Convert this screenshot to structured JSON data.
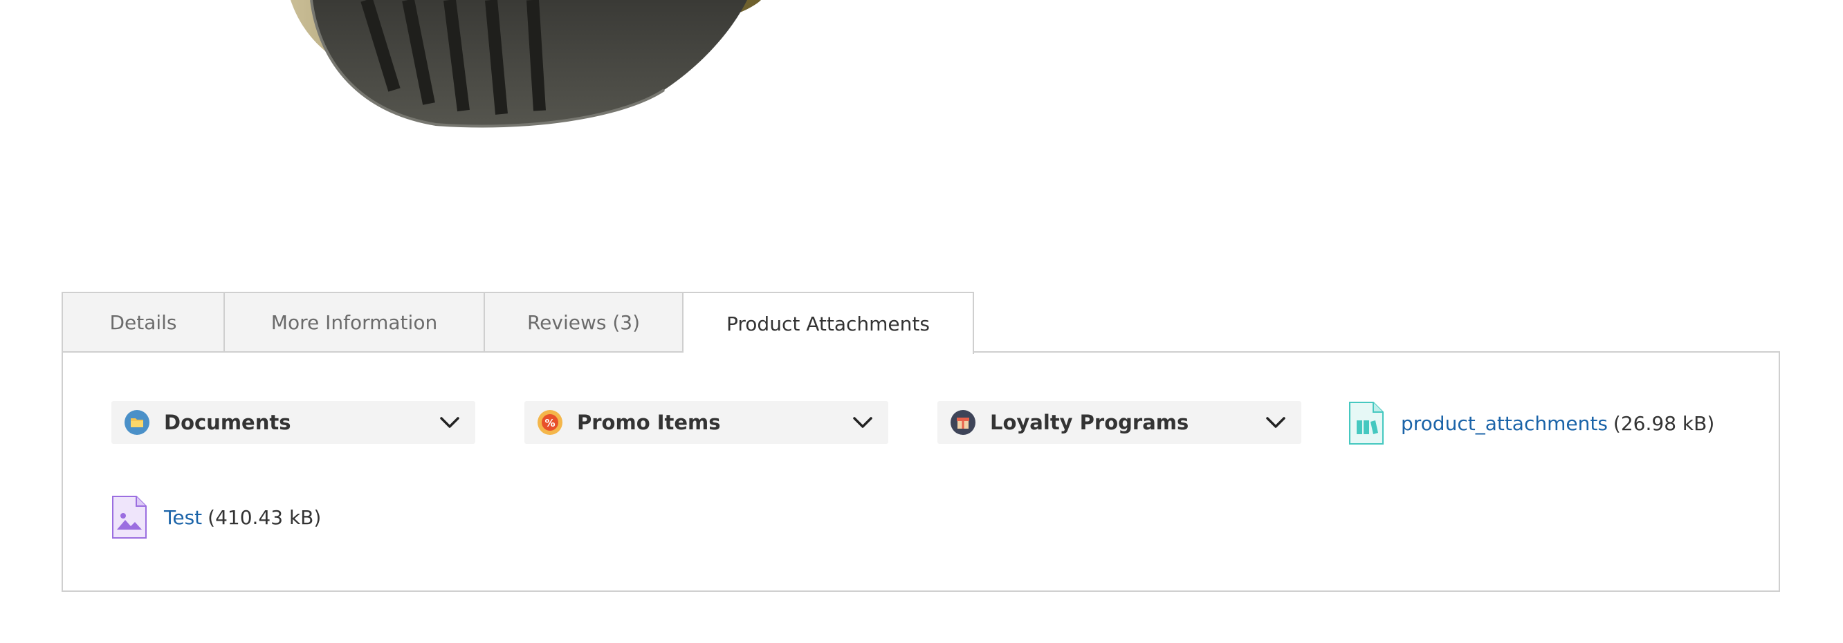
{
  "tabs": [
    {
      "label": "Details"
    },
    {
      "label": "More Information"
    },
    {
      "label": "Reviews (3)"
    },
    {
      "label": "Product Attachments"
    }
  ],
  "active_tab": "Product Attachments",
  "categories": [
    {
      "label": "Documents",
      "icon": "folder-icon",
      "color": "#4a90c8"
    },
    {
      "label": "Promo Items",
      "icon": "discount-badge-icon",
      "color": "#e8502a"
    },
    {
      "label": "Loyalty Programs",
      "icon": "gift-icon",
      "color": "#3e4458"
    }
  ],
  "attachments": [
    {
      "name": "product_attachments",
      "size": "(26.98 kB)",
      "icon": "archive-file-icon",
      "color": "#45c8c0"
    },
    {
      "name": "Test",
      "size": "(410.43 kB)",
      "icon": "image-file-icon",
      "color": "#9b6ee0"
    }
  ],
  "colors": {
    "link": "#1a63a8",
    "tab_bg": "#f3f3f3",
    "border": "#cfcfcf"
  }
}
